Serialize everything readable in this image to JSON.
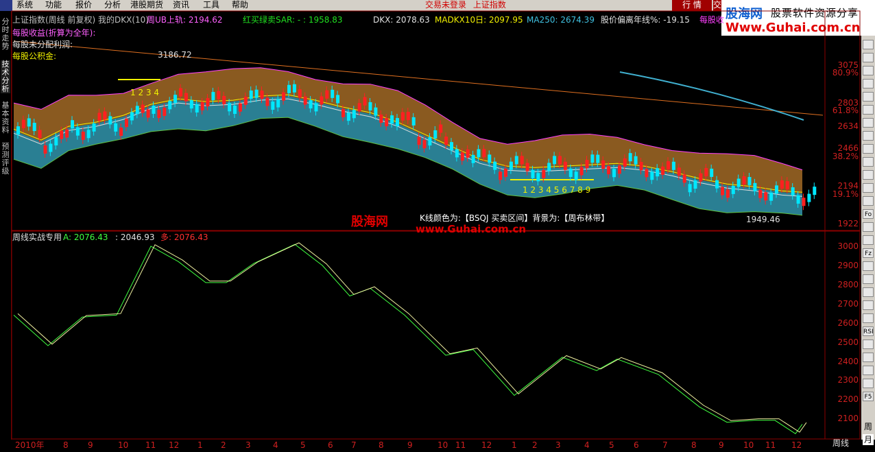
{
  "menu": {
    "items": [
      "系统",
      "功能",
      "报价",
      "分析",
      "港股期货",
      "资讯",
      "工具",
      "帮助"
    ],
    "status": "交易未登录",
    "current_index": "上证指数",
    "btn_hq": "行 情",
    "btn_jy": "交"
  },
  "watermark": {
    "site": "股海网",
    "slogan": "股票软件资源分享",
    "url": "Www.Guhai.com.cn"
  },
  "left_tabs": [
    "分时走势",
    "技术分析",
    "基本资料",
    "预测评级"
  ],
  "top_pane": {
    "title": "上证指数(周线 前复权) 我的DKX(10)",
    "ub_label": "周UB上轨: 2194.62",
    "sar_label": "红买绿卖SAR: - : 1958.83",
    "dkx": "DKX: 2078.63",
    "madkx": "MADKX10日: 2097.95",
    "ma250": "MA250: 2674.39",
    "bias": "股价偏离年线%: -19.15",
    "eps": "每股收",
    "info1": "每股收益(折算为全年):",
    "info2": "每股未分配利润:",
    "info3": "每股公积金:",
    "high_label": "3186.72",
    "low_label": "1949.46",
    "count1": "1 2 3 4",
    "count2": "1 2 3 4 5 6 7 8 9",
    "legend": "K线颜色为:【BSQJ 买卖区间】背景为:【周布林带】",
    "y_ticks": [
      "3075",
      "80.9%",
      "2803",
      "61.8%",
      "2634",
      "2466",
      "38.2%",
      "2194",
      "19.1%",
      "1922"
    ]
  },
  "bottom_pane": {
    "title": "周线实战专用",
    "a_label": "A: 2076.43",
    "b_label": ": 2046.93",
    "duo_label": "多: 2076.43",
    "y_ticks": [
      "3000",
      "2900",
      "2800",
      "2700",
      "2600",
      "2500",
      "2400",
      "2300",
      "2200",
      "2100"
    ]
  },
  "x_axis": {
    "ticks": [
      "2010年",
      "8",
      "9",
      "10",
      "11",
      "12",
      "1",
      "2",
      "3",
      "4",
      "5",
      "6",
      "7",
      "8",
      "9",
      "10",
      "11",
      "12",
      "1",
      "2",
      "3",
      "4",
      "5",
      "6",
      "7",
      "8",
      "9",
      "10",
      "11",
      "12"
    ],
    "period": "周线"
  },
  "watermark_mid": {
    "site": "股海网",
    "url": "www.Guhai.com.cn"
  },
  "toolbar": [
    "",
    "",
    "",
    "",
    "",
    "",
    "",
    "",
    "",
    "",
    "",
    "",
    "",
    "Fo",
    "",
    "",
    "Fz",
    "",
    "",
    "",
    "",
    "",
    "RSI",
    "",
    "",
    "",
    "",
    "F5"
  ],
  "period_btn": "周",
  "period_btn2": "月",
  "colors": {
    "up": "#ff2020",
    "down": "#00e8ff",
    "band": "#8a5a20",
    "band_inner": "#2a8aa0",
    "yellow": "#f0f000",
    "axis": "#d02020"
  }
}
